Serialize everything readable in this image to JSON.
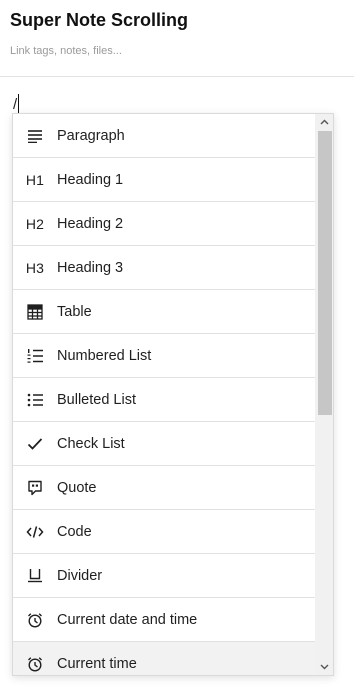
{
  "note": {
    "title": "Super Note Scrolling",
    "tags_placeholder": "Link tags, notes, files..."
  },
  "editor": {
    "text": "/"
  },
  "menu": {
    "items": [
      {
        "label": "Paragraph",
        "icon": "paragraph-icon"
      },
      {
        "label": "Heading 1",
        "icon": "h1-icon",
        "glyph": "H1"
      },
      {
        "label": "Heading 2",
        "icon": "h2-icon",
        "glyph": "H2"
      },
      {
        "label": "Heading 3",
        "icon": "h3-icon",
        "glyph": "H3"
      },
      {
        "label": "Table",
        "icon": "table-icon"
      },
      {
        "label": "Numbered List",
        "icon": "numbered-list-icon"
      },
      {
        "label": "Bulleted List",
        "icon": "bulleted-list-icon"
      },
      {
        "label": "Check List",
        "icon": "check-icon"
      },
      {
        "label": "Quote",
        "icon": "quote-icon"
      },
      {
        "label": "Code",
        "icon": "code-icon"
      },
      {
        "label": "Divider",
        "icon": "divider-icon"
      },
      {
        "label": "Current date and time",
        "icon": "clock-icon"
      },
      {
        "label": "Current time",
        "icon": "clock-icon"
      }
    ]
  },
  "colors": {
    "border": "#dadada",
    "scrollbar_track": "#f1f1f1",
    "scrollbar_thumb": "#c6c6c6",
    "highlight": "#f2f2f2"
  }
}
